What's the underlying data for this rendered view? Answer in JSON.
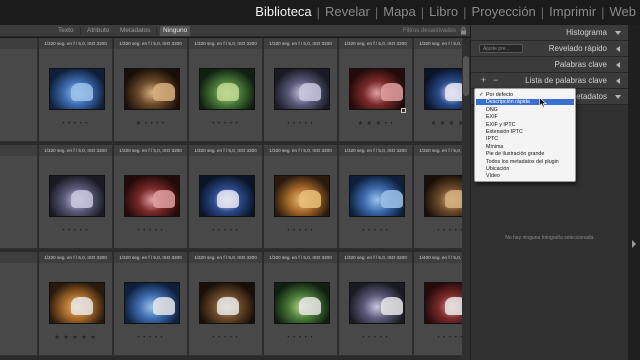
{
  "modules": [
    "Biblioteca",
    "Revelar",
    "Mapa",
    "Libro",
    "Proyección",
    "Imprimir",
    "Web"
  ],
  "active_module": "Biblioteca",
  "filter_bar": {
    "tabs": [
      "Texto",
      "Atributo",
      "Metadatos",
      "Ninguno"
    ],
    "selected": "Ninguno",
    "filters_label": "Filtros desactivados"
  },
  "grid": {
    "rows": [
      {
        "cells": [
          {
            "meta": "",
            "stars": ""
          },
          {
            "meta": "1/320 seg. en f / 5,0, ISO 3200",
            "stars": "• • • • •"
          },
          {
            "meta": "1/320 seg. en f / 5,0, ISO 3200",
            "stars": "★ • • • •"
          },
          {
            "meta": "1/320 seg. en f / 5,0, ISO 3200",
            "stars": "• • • • •"
          },
          {
            "meta": "1/320 seg. en f / 5,0, ISO 3200",
            "stars": "• • • • •"
          },
          {
            "meta": "1/320 seg. en f / 5,0, ISO 3200",
            "stars": "★ ★ ★ • •"
          },
          {
            "meta": "1/320 seg. en f / 5,0, ISO 3200",
            "stars": "★ ★ ★ ★ •"
          }
        ]
      },
      {
        "cells": [
          {
            "meta": "",
            "stars": ""
          },
          {
            "meta": "1/320 seg. en f / 5,0, ISO 3200",
            "stars": "• • • • •"
          },
          {
            "meta": "1/320 seg. en f / 5,0, ISO 3200",
            "stars": "• • • • •"
          },
          {
            "meta": "1/320 seg. en f / 5,0, ISO 3200",
            "stars": "• • • • •"
          },
          {
            "meta": "1/320 seg. en f / 5,0, ISO 3200",
            "stars": "• • • • •"
          },
          {
            "meta": "1/320 seg. en f / 5,0, ISO 3200",
            "stars": "• • • • •"
          },
          {
            "meta": "1/320 seg. en f / 5,0, ISO 3200",
            "stars": "• • • • •"
          }
        ]
      },
      {
        "cells": [
          {
            "meta": "",
            "stars": ""
          },
          {
            "meta": "1/320 seg. en f / 5,0, ISO 3200",
            "stars": "★ ★ ★ ★ ★"
          },
          {
            "meta": "1/320 seg. en f / 5,0, ISO 3200",
            "stars": "• • • • •"
          },
          {
            "meta": "1/320 seg. en f / 5,0, ISO 3200",
            "stars": "• • • • •"
          },
          {
            "meta": "1/320 seg. en f / 5,0, ISO 3200",
            "stars": "• • • • •"
          },
          {
            "meta": "1/320 seg. en f / 5,0, ISO 3200",
            "stars": "• • • • •"
          },
          {
            "meta": "1/400 seg. en f / 5,0, ISO 2000",
            "stars": "• • • • •"
          }
        ]
      }
    ]
  },
  "right_panel": {
    "histograma": "Histograma",
    "revelado_rapido": "Revelado rápido",
    "ajuste_preset": "Ajuste pre...",
    "palabras_clave": "Palabras clave",
    "lista_palabras_clave": "Lista de palabras clave",
    "metadatos": "Metadatos",
    "plus": "+",
    "minus": "−",
    "empty_message": "No hay ninguna fotografía seleccionada."
  },
  "dropdown": {
    "checked_index": 0,
    "highlighted_index": 1,
    "options": [
      "Por defecto",
      "Descripción rápida",
      "DNG",
      "EXIF",
      "EXIF y IPTC",
      "Extensión IPTC",
      "IPTC",
      "Mínima",
      "Pie de ilustración grande",
      "Todos los metadatos del plugin",
      "Ubicación",
      "Vídeo"
    ],
    "check_glyph": "✓"
  },
  "colors": {
    "accent_highlight": "#3a6fd0",
    "active_module": "#f2f2f2",
    "inactive_module": "#8b8b8b"
  }
}
